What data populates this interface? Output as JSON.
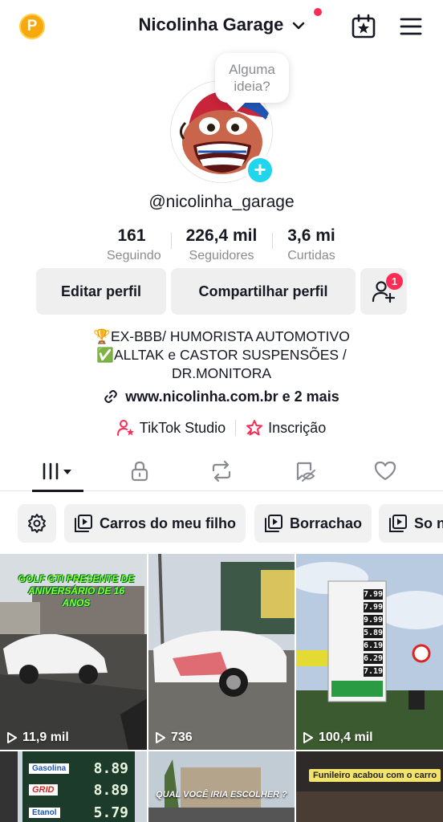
{
  "header": {
    "coin_letter": "P",
    "account_name": "Nicolinha Garage",
    "icons": [
      "coin-icon",
      "chevron-down-icon",
      "calendar-star-icon",
      "menu-icon"
    ]
  },
  "profile": {
    "bubble_text_1": "Alguma",
    "bubble_text_2": "ideia?",
    "username": "@nicolinha_garage"
  },
  "stats": [
    {
      "value": "161",
      "label": "Seguindo"
    },
    {
      "value": "226,4 mil",
      "label": "Seguidores"
    },
    {
      "value": "3,6 mi",
      "label": "Curtidas"
    }
  ],
  "buttons": {
    "edit": "Editar perfil",
    "share": "Compartilhar perfil",
    "add_friends_badge": "1"
  },
  "bio": {
    "line1": "🏆EX-BBB/ HUMORISTA AUTOMOTIVO",
    "line2": "✅ALLTAK e CASTOR SUSPENSÕES /",
    "line3": "DR.MONITORA",
    "link": "www.nicolinha.com.br e 2 mais"
  },
  "tools": {
    "studio": "TikTok Studio",
    "subscription": "Inscrição"
  },
  "playlists": [
    {
      "label": "Carros do meu filho"
    },
    {
      "label": "Borrachao"
    },
    {
      "label": "So n"
    }
  ],
  "videos": [
    {
      "views": "11,9 mil",
      "caption": "GOLF GTI PRESENTE DE ANIVERSÁRIO DE 16 ANOS"
    },
    {
      "views": "736",
      "caption": ""
    },
    {
      "views": "100,4 mil",
      "caption": ""
    },
    {
      "views": "",
      "caption": ""
    },
    {
      "views": "",
      "caption": "QUAL VOCÊ IRIA ESCOLHER ?"
    },
    {
      "views": "",
      "caption": "Funileiro acabou com o carro"
    }
  ],
  "fuel_sign_prices": [
    "7.99",
    "7.99",
    "9.99",
    "5.89",
    "6.19",
    "6.29",
    "7.19"
  ],
  "pump_sign": {
    "line1": "Gasolina",
    "price1": "8.89",
    "line2": "GRID",
    "price2": "8.89",
    "line3": "Etanol",
    "price3": "5.79"
  },
  "colors": {
    "accent": "#fe2c55",
    "cyan": "#20d5ec",
    "coin": "#f7a80f",
    "text": "#161823",
    "muted": "#8a8b91"
  }
}
